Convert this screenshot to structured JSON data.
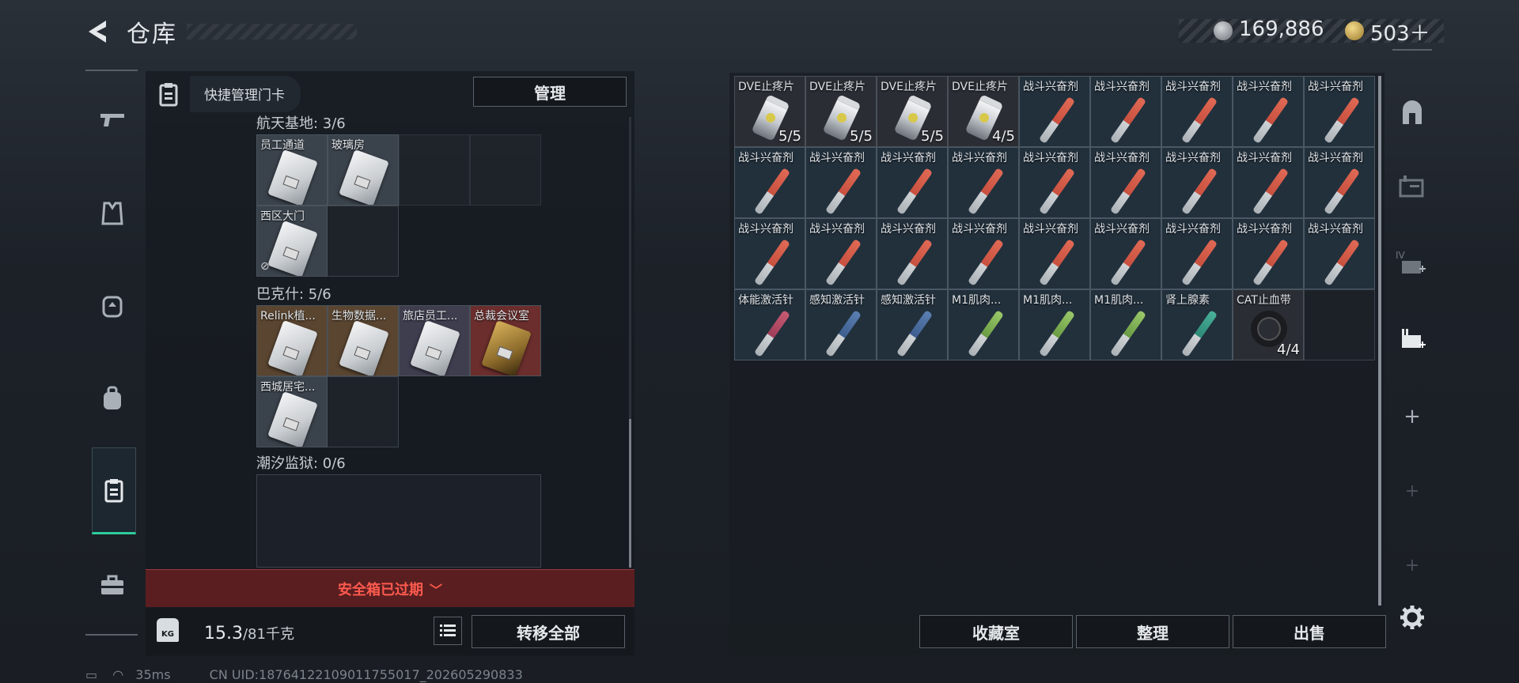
{
  "header": {
    "title": "仓库"
  },
  "currency": {
    "silver": "169,886",
    "gold": "503＋"
  },
  "left_panel": {
    "quick_manage_label": "快捷管理门卡",
    "manage_button": "管理",
    "groups": [
      {
        "label": "航天基地: 3/6",
        "cards": [
          "员工通道",
          "玻璃房",
          "西区大门"
        ]
      },
      {
        "label": "巴克什: 5/6",
        "cards": [
          "Relink植...",
          "生物数据...",
          "旅店员工...",
          "总裁会议室",
          "西城居宅..."
        ]
      },
      {
        "label": "潮汐监狱: 0/6",
        "cards": []
      }
    ],
    "expired_text": "安全箱已过期",
    "weight_value": "15.3",
    "weight_total": "/81千克",
    "transfer_all": "转移全部"
  },
  "status_bar": {
    "ping": "35ms",
    "uid": "CN UID:18764122109011755017_202605290833"
  },
  "grid": {
    "rows": [
      [
        {
          "label": "DVE止疼片",
          "count": "5/5",
          "kind": "pill"
        },
        {
          "label": "DVE止疼片",
          "count": "5/5",
          "kind": "pill"
        },
        {
          "label": "DVE止疼片",
          "count": "5/5",
          "kind": "pill"
        },
        {
          "label": "DVE止疼片",
          "count": "4/5",
          "kind": "pill"
        },
        {
          "label": "战斗兴奋剂",
          "count": "",
          "kind": "syringe"
        },
        {
          "label": "战斗兴奋剂",
          "count": "",
          "kind": "syringe"
        },
        {
          "label": "战斗兴奋剂",
          "count": "",
          "kind": "syringe"
        },
        {
          "label": "战斗兴奋剂",
          "count": "",
          "kind": "syringe"
        },
        {
          "label": "战斗兴奋剂",
          "count": "",
          "kind": "syringe"
        }
      ],
      [
        {
          "label": "战斗兴奋剂",
          "count": "",
          "kind": "syringe"
        },
        {
          "label": "战斗兴奋剂",
          "count": "",
          "kind": "syringe"
        },
        {
          "label": "战斗兴奋剂",
          "count": "",
          "kind": "syringe"
        },
        {
          "label": "战斗兴奋剂",
          "count": "",
          "kind": "syringe"
        },
        {
          "label": "战斗兴奋剂",
          "count": "",
          "kind": "syringe"
        },
        {
          "label": "战斗兴奋剂",
          "count": "",
          "kind": "syringe"
        },
        {
          "label": "战斗兴奋剂",
          "count": "",
          "kind": "syringe"
        },
        {
          "label": "战斗兴奋剂",
          "count": "",
          "kind": "syringe"
        },
        {
          "label": "战斗兴奋剂",
          "count": "",
          "kind": "syringe"
        }
      ],
      [
        {
          "label": "战斗兴奋剂",
          "count": "",
          "kind": "syringe"
        },
        {
          "label": "战斗兴奋剂",
          "count": "",
          "kind": "syringe"
        },
        {
          "label": "战斗兴奋剂",
          "count": "",
          "kind": "syringe"
        },
        {
          "label": "战斗兴奋剂",
          "count": "",
          "kind": "syringe"
        },
        {
          "label": "战斗兴奋剂",
          "count": "",
          "kind": "syringe"
        },
        {
          "label": "战斗兴奋剂",
          "count": "",
          "kind": "syringe"
        },
        {
          "label": "战斗兴奋剂",
          "count": "",
          "kind": "syringe"
        },
        {
          "label": "战斗兴奋剂",
          "count": "",
          "kind": "syringe"
        },
        {
          "label": "战斗兴奋剂",
          "count": "",
          "kind": "syringe"
        }
      ],
      [
        {
          "label": "体能激活针",
          "count": "",
          "kind": "syringe-pink"
        },
        {
          "label": "感知激活针",
          "count": "",
          "kind": "syringe-blue"
        },
        {
          "label": "感知激活针",
          "count": "",
          "kind": "syringe-blue"
        },
        {
          "label": "M1肌肉...",
          "count": "",
          "kind": "syringe-green"
        },
        {
          "label": "M1肌肉...",
          "count": "",
          "kind": "syringe-green"
        },
        {
          "label": "M1肌肉...",
          "count": "",
          "kind": "syringe-green"
        },
        {
          "label": "肾上腺素",
          "count": "",
          "kind": "syringe-teal"
        },
        {
          "label": "CAT止血带",
          "count": "4/4",
          "kind": "tourniquet"
        },
        {
          "label": "",
          "count": "",
          "kind": "empty"
        }
      ]
    ]
  },
  "bottom_buttons": {
    "collection": "收藏室",
    "sort": "整理",
    "sell": "出售"
  },
  "right_nav": {
    "tier_label": "IV"
  }
}
